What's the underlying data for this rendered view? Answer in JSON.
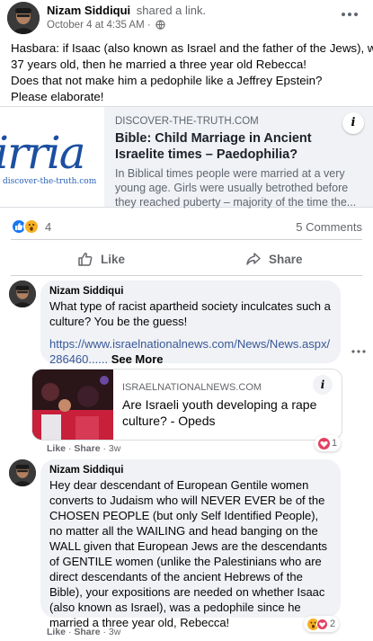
{
  "post": {
    "author": "Nizam Siddiqui",
    "action": "shared a link.",
    "timestamp": "October 4 at 4:35 AM",
    "dot": "·",
    "privacy_icon": "globe-icon",
    "more_icon": "ellipsis-icon",
    "text_lines": [
      "Hasbara: if Isaac (also known as Israel and the father of the Jews), was",
      "37 years old, then he married a three year old Rebecca!",
      "Does that not make him a pedophile like a Jeffrey Epstein?",
      "Please elaborate!"
    ]
  },
  "link_preview": {
    "thumb_word": "irria",
    "thumb_sub": "discover-the-truth.com",
    "domain": "DISCOVER-THE-TRUTH.COM",
    "title": "Bible: Child Marriage in Ancient Israelite times – Paedophilia?",
    "description": "In Biblical times people were married at a very young age. Girls were usually betrothed before they reached puberty – majority of the time the...",
    "info_icon": "i"
  },
  "stats": {
    "reaction_count": "4",
    "comments": "5 Comments",
    "reaction_types": [
      "like",
      "wow"
    ]
  },
  "actions": {
    "like": "Like",
    "share": "Share"
  },
  "comments": [
    {
      "author": "Nizam Siddiqui",
      "text": "What type of racist apartheid society inculcates such a culture? You be the guess!",
      "link": "https://www.israelnationalnews.com/News/News.aspx/286460......",
      "see_more": "See More",
      "embed": {
        "domain": "ISRAELNATIONALNEWS.COM",
        "title": "Are Israeli youth developing a rape culture? - Opeds",
        "info_icon": "i"
      },
      "footer": {
        "like": "Like",
        "sep": "·",
        "share": "Share",
        "time": "3w"
      },
      "reactions": {
        "count": "1",
        "types": [
          "love"
        ]
      }
    },
    {
      "author": "Nizam Siddiqui",
      "text": "Hey dear descendant of European Gentile women converts to Judaism who will NEVER EVER be of the CHOSEN PEOPLE (but only Self Identified People), no matter all the WAILING and head banging on the WALL given that European Jews are the descendants of GENTILE women (unlike the Palestinians who are direct descendants of the ancient Hebrews of the Bible), your expositions are needed on whether Isaac (also known as Israel), was a pedophile since he married a three year old, Rebecca!",
      "footer": {
        "like": "Like",
        "sep": "·",
        "share": "Share",
        "time": "3w"
      },
      "reactions": {
        "count": "2",
        "types": [
          "wow",
          "love"
        ]
      }
    }
  ],
  "colors": {
    "link_blue": "#385898",
    "like_blue": "#1877f2",
    "wow_yellow": "#f7b125",
    "love_red": "#e4405f",
    "bubble_gray": "#f0f2f5"
  }
}
